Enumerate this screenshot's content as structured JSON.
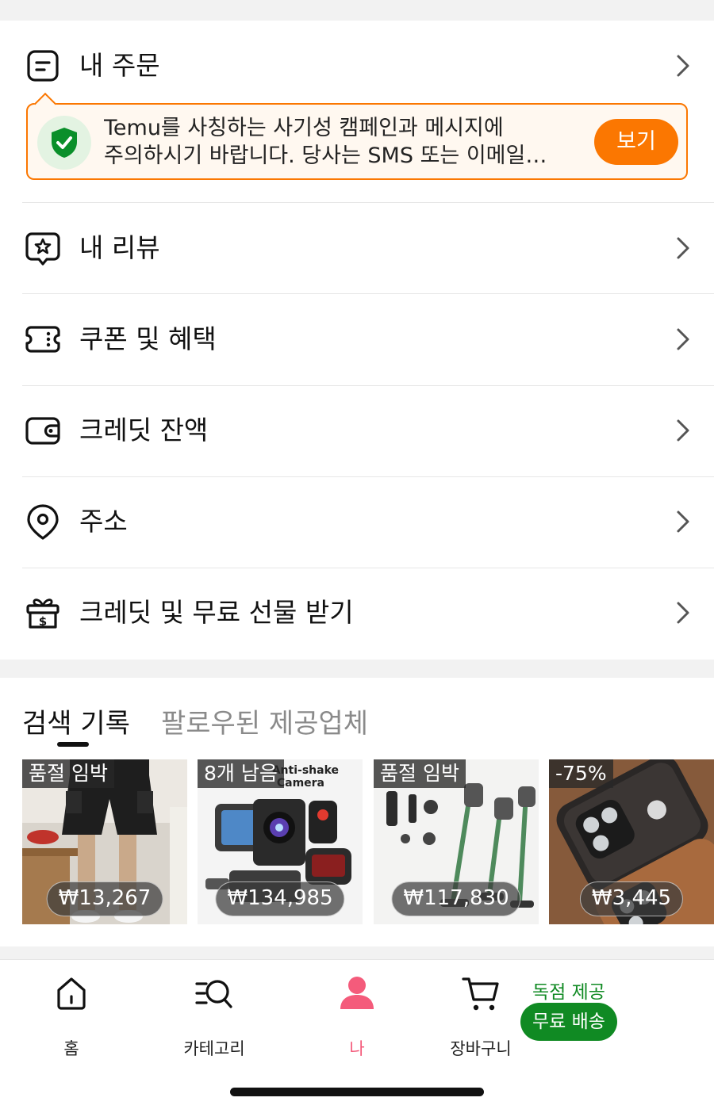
{
  "menu": {
    "orders_label": "내 주문",
    "reviews_label": "내 리뷰",
    "coupons_label": "쿠폰 및 혜택",
    "credit_label": "크레딧 잔액",
    "address_label": "주소",
    "gift_label": "크레딧 및 무료 선물 받기"
  },
  "notice": {
    "line1": "Temu를 사칭하는 사기성 캠페인과 메시지에",
    "line2": "주의하시기 바랍니다. 당사는 SMS 또는 이메일…",
    "button_label": "보기"
  },
  "history": {
    "tab_search": "검색 기록",
    "tab_followed": "팔로우된 제공업체",
    "products": [
      {
        "badge": "품절 임박",
        "price": "₩13,267",
        "icon": "cargo-shorts-image"
      },
      {
        "badge": "8개 남음",
        "price": "₩134,985",
        "icon": "action-camera-image"
      },
      {
        "badge": "품절 임박",
        "price": "₩117,830",
        "icon": "cordless-vacuum-image"
      },
      {
        "badge": "-75%",
        "price": "₩3,445",
        "icon": "leather-phone-case-image"
      }
    ]
  },
  "tabbar": {
    "home": "홈",
    "category": "카테고리",
    "me": "나",
    "cart": "장바구니",
    "promo_top": "독점 제공",
    "promo_pill": "무료 배송"
  },
  "colors": {
    "accent": "#fb7701",
    "active_tab": "#f45b7b",
    "promo_green": "#108a23"
  }
}
